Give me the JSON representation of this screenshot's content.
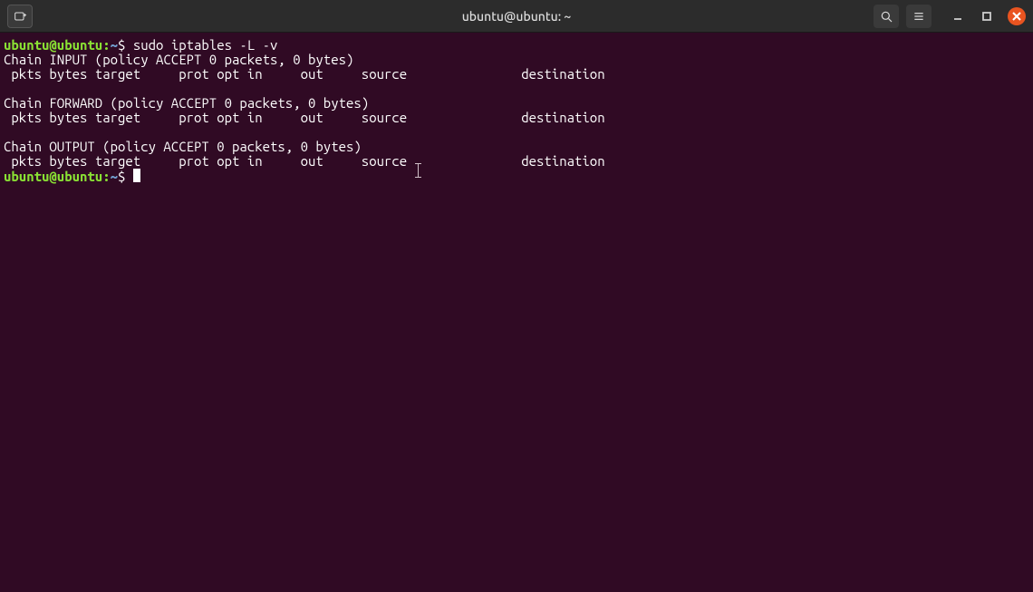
{
  "window": {
    "title": "ubuntu@ubuntu: ~"
  },
  "prompt": {
    "user_host": "ubuntu@ubuntu",
    "separator": ":",
    "path": "~",
    "symbol": "$"
  },
  "command1": "sudo iptables -L -v",
  "output": {
    "chain_input_header": "Chain INPUT (policy ACCEPT 0 packets, 0 bytes)",
    "columns_line": " pkts bytes target     prot opt in     out     source               destination",
    "chain_forward_header": "Chain FORWARD (policy ACCEPT 0 packets, 0 bytes)",
    "chain_output_header": "Chain OUTPUT (policy ACCEPT 0 packets, 0 bytes)"
  }
}
